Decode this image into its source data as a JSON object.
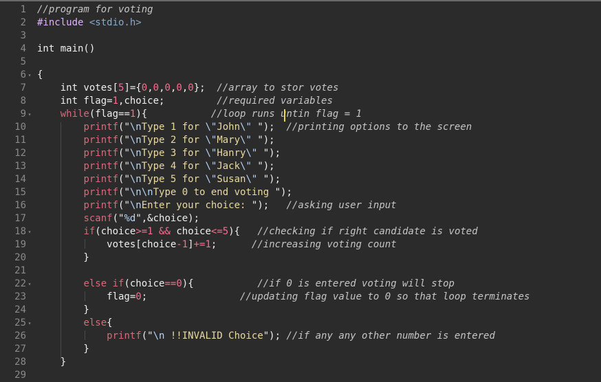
{
  "editor": {
    "lines": [
      {
        "n": "1",
        "fold": "",
        "tokens": [
          {
            "t": "//program for voting",
            "c": "comment"
          }
        ]
      },
      {
        "n": "2",
        "fold": "",
        "tokens": [
          {
            "t": "#include ",
            "c": "pre"
          },
          {
            "t": "<stdio.h>",
            "c": "include"
          }
        ]
      },
      {
        "n": "3",
        "fold": "",
        "tokens": []
      },
      {
        "n": "4",
        "fold": "",
        "tokens": [
          {
            "t": "int main()",
            "c": "kw"
          }
        ]
      },
      {
        "n": "5",
        "fold": "",
        "tokens": []
      },
      {
        "n": "6",
        "fold": "▾",
        "tokens": [
          {
            "t": "{",
            "c": "kw"
          }
        ]
      },
      {
        "n": "7",
        "fold": "",
        "tokens": [
          {
            "t": "    int votes[",
            "c": "kw"
          },
          {
            "t": "5",
            "c": "num"
          },
          {
            "t": "]=",
            "c": "kw"
          },
          {
            "t": "{",
            "c": "kw"
          },
          {
            "t": "0",
            "c": "num"
          },
          {
            "t": ",",
            "c": "kw"
          },
          {
            "t": "0",
            "c": "num"
          },
          {
            "t": ",",
            "c": "kw"
          },
          {
            "t": "0",
            "c": "num"
          },
          {
            "t": ",",
            "c": "kw"
          },
          {
            "t": "0",
            "c": "num"
          },
          {
            "t": ",",
            "c": "kw"
          },
          {
            "t": "0",
            "c": "num"
          },
          {
            "t": "};  ",
            "c": "kw"
          },
          {
            "t": "//array to stor votes",
            "c": "comment"
          }
        ]
      },
      {
        "n": "8",
        "fold": "",
        "tokens": [
          {
            "t": "    int flag=",
            "c": "kw"
          },
          {
            "t": "1",
            "c": "num"
          },
          {
            "t": ",choice;         ",
            "c": "kw"
          },
          {
            "t": "//required variables",
            "c": "comment"
          }
        ]
      },
      {
        "n": "9",
        "fold": "▾",
        "tokens": [
          {
            "t": "    ",
            "c": "kw"
          },
          {
            "t": "while",
            "c": "ctl"
          },
          {
            "t": "(flag==",
            "c": "kw"
          },
          {
            "t": "1",
            "c": "num"
          },
          {
            "t": "){           ",
            "c": "kw"
          },
          {
            "t": "//loop runs untin flag = 1",
            "c": "comment"
          }
        ]
      },
      {
        "n": "10",
        "fold": "",
        "tokens": [
          {
            "t": "        ",
            "c": "kw"
          },
          {
            "t": "printf",
            "c": "fn"
          },
          {
            "t": "(\"",
            "c": "kw"
          },
          {
            "t": "\\n",
            "c": "esc"
          },
          {
            "t": "Type 1 for ",
            "c": "str"
          },
          {
            "t": "\\\"",
            "c": "esc"
          },
          {
            "t": "John",
            "c": "str"
          },
          {
            "t": "\\\"",
            "c": "esc"
          },
          {
            "t": " \");  ",
            "c": "kw"
          },
          {
            "t": "//printing options to the screen",
            "c": "comment"
          }
        ]
      },
      {
        "n": "11",
        "fold": "",
        "tokens": [
          {
            "t": "        ",
            "c": "kw"
          },
          {
            "t": "printf",
            "c": "fn"
          },
          {
            "t": "(\"",
            "c": "kw"
          },
          {
            "t": "\\n",
            "c": "esc"
          },
          {
            "t": "Type 2 for ",
            "c": "str"
          },
          {
            "t": "\\\"",
            "c": "esc"
          },
          {
            "t": "Mary",
            "c": "str"
          },
          {
            "t": "\\\"",
            "c": "esc"
          },
          {
            "t": " \");",
            "c": "kw"
          }
        ]
      },
      {
        "n": "12",
        "fold": "",
        "tokens": [
          {
            "t": "        ",
            "c": "kw"
          },
          {
            "t": "printf",
            "c": "fn"
          },
          {
            "t": "(\"",
            "c": "kw"
          },
          {
            "t": "\\n",
            "c": "esc"
          },
          {
            "t": "Type 3 for ",
            "c": "str"
          },
          {
            "t": "\\\"",
            "c": "esc"
          },
          {
            "t": "Hanry",
            "c": "str"
          },
          {
            "t": "\\\"",
            "c": "esc"
          },
          {
            "t": " \");",
            "c": "kw"
          }
        ]
      },
      {
        "n": "13",
        "fold": "",
        "tokens": [
          {
            "t": "        ",
            "c": "kw"
          },
          {
            "t": "printf",
            "c": "fn"
          },
          {
            "t": "(\"",
            "c": "kw"
          },
          {
            "t": "\\n",
            "c": "esc"
          },
          {
            "t": "Type 4 for ",
            "c": "str"
          },
          {
            "t": "\\\"",
            "c": "esc"
          },
          {
            "t": "Jack",
            "c": "str"
          },
          {
            "t": "\\\"",
            "c": "esc"
          },
          {
            "t": " \");",
            "c": "kw"
          }
        ]
      },
      {
        "n": "14",
        "fold": "",
        "tokens": [
          {
            "t": "        ",
            "c": "kw"
          },
          {
            "t": "printf",
            "c": "fn"
          },
          {
            "t": "(\"",
            "c": "kw"
          },
          {
            "t": "\\n",
            "c": "esc"
          },
          {
            "t": "Type 5 for ",
            "c": "str"
          },
          {
            "t": "\\\"",
            "c": "esc"
          },
          {
            "t": "Susan",
            "c": "str"
          },
          {
            "t": "\\\"",
            "c": "esc"
          },
          {
            "t": " \");",
            "c": "kw"
          }
        ]
      },
      {
        "n": "15",
        "fold": "",
        "tokens": [
          {
            "t": "        ",
            "c": "kw"
          },
          {
            "t": "printf",
            "c": "fn"
          },
          {
            "t": "(\"",
            "c": "kw"
          },
          {
            "t": "\\n\\n",
            "c": "esc"
          },
          {
            "t": "Type 0 to end voting ",
            "c": "str"
          },
          {
            "t": "\");",
            "c": "kw"
          }
        ]
      },
      {
        "n": "16",
        "fold": "",
        "tokens": [
          {
            "t": "        ",
            "c": "kw"
          },
          {
            "t": "printf",
            "c": "fn"
          },
          {
            "t": "(\"",
            "c": "kw"
          },
          {
            "t": "\\n",
            "c": "esc"
          },
          {
            "t": "Enter your choice: ",
            "c": "str"
          },
          {
            "t": "\");   ",
            "c": "kw"
          },
          {
            "t": "//asking user input",
            "c": "comment"
          }
        ]
      },
      {
        "n": "17",
        "fold": "",
        "tokens": [
          {
            "t": "        ",
            "c": "kw"
          },
          {
            "t": "scanf",
            "c": "fn"
          },
          {
            "t": "(\"",
            "c": "kw"
          },
          {
            "t": "%d",
            "c": "esc"
          },
          {
            "t": "\",&choice);",
            "c": "kw"
          }
        ]
      },
      {
        "n": "18",
        "fold": "▾",
        "tokens": [
          {
            "t": "        ",
            "c": "kw"
          },
          {
            "t": "if",
            "c": "ctl"
          },
          {
            "t": "(choice",
            "c": "kw"
          },
          {
            "t": ">=",
            "c": "op"
          },
          {
            "t": "1",
            "c": "num"
          },
          {
            "t": " ",
            "c": "kw"
          },
          {
            "t": "&&",
            "c": "op"
          },
          {
            "t": " choice",
            "c": "kw"
          },
          {
            "t": "<=",
            "c": "op"
          },
          {
            "t": "5",
            "c": "num"
          },
          {
            "t": "){   ",
            "c": "kw"
          },
          {
            "t": "//checking if right candidate is voted",
            "c": "comment"
          }
        ]
      },
      {
        "n": "19",
        "fold": "",
        "tokens": [
          {
            "t": "            votes[choice",
            "c": "kw"
          },
          {
            "t": "-",
            "c": "op"
          },
          {
            "t": "1",
            "c": "num"
          },
          {
            "t": "]",
            "c": "kw"
          },
          {
            "t": "+=",
            "c": "op"
          },
          {
            "t": "1",
            "c": "num"
          },
          {
            "t": ";      ",
            "c": "kw"
          },
          {
            "t": "//increasing voting count",
            "c": "comment"
          }
        ]
      },
      {
        "n": "20",
        "fold": "",
        "tokens": [
          {
            "t": "        }",
            "c": "kw"
          }
        ]
      },
      {
        "n": "21",
        "fold": "",
        "tokens": []
      },
      {
        "n": "22",
        "fold": "▾",
        "tokens": [
          {
            "t": "        ",
            "c": "kw"
          },
          {
            "t": "else if",
            "c": "ctl"
          },
          {
            "t": "(choice",
            "c": "kw"
          },
          {
            "t": "==",
            "c": "op"
          },
          {
            "t": "0",
            "c": "num"
          },
          {
            "t": "){           ",
            "c": "kw"
          },
          {
            "t": "//if 0 is entered voting will stop",
            "c": "comment"
          }
        ]
      },
      {
        "n": "23",
        "fold": "",
        "tokens": [
          {
            "t": "            flag=",
            "c": "kw"
          },
          {
            "t": "0",
            "c": "num"
          },
          {
            "t": ";                ",
            "c": "kw"
          },
          {
            "t": "//updating flag value to 0 so that loop terminates",
            "c": "comment"
          }
        ]
      },
      {
        "n": "24",
        "fold": "",
        "tokens": [
          {
            "t": "        }",
            "c": "kw"
          }
        ]
      },
      {
        "n": "25",
        "fold": "▾",
        "tokens": [
          {
            "t": "        ",
            "c": "kw"
          },
          {
            "t": "else",
            "c": "ctl"
          },
          {
            "t": "{",
            "c": "kw"
          }
        ]
      },
      {
        "n": "26",
        "fold": "",
        "tokens": [
          {
            "t": "            ",
            "c": "kw"
          },
          {
            "t": "printf",
            "c": "fn"
          },
          {
            "t": "(\"",
            "c": "kw"
          },
          {
            "t": "\\n",
            "c": "esc"
          },
          {
            "t": " !!INVALID Choice",
            "c": "str"
          },
          {
            "t": "\"); ",
            "c": "kw"
          },
          {
            "t": "//if any any other number is entered",
            "c": "comment"
          }
        ]
      },
      {
        "n": "27",
        "fold": "",
        "tokens": [
          {
            "t": "        }",
            "c": "kw"
          }
        ]
      },
      {
        "n": "28",
        "fold": "",
        "tokens": [
          {
            "t": "    }",
            "c": "kw"
          }
        ]
      },
      {
        "n": "29",
        "fold": "",
        "tokens": []
      }
    ]
  }
}
